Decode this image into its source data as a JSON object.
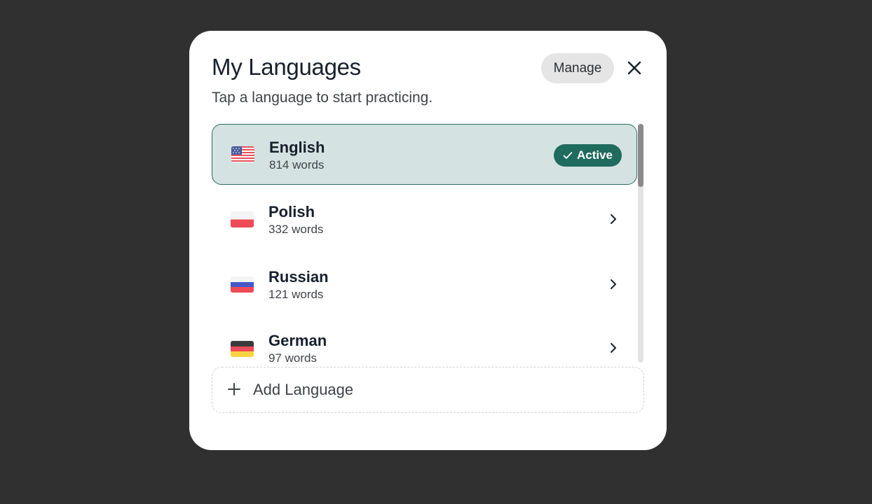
{
  "modal": {
    "title": "My Languages",
    "subtitle": "Tap a language to start practicing.",
    "manage_label": "Manage",
    "close_icon": "close-icon"
  },
  "languages": [
    {
      "name": "English",
      "count": "814 words",
      "flag": "us-flag-icon",
      "active": true,
      "badge": "Active"
    },
    {
      "name": "Polish",
      "count": "332 words",
      "flag": "pl-flag-icon",
      "active": false
    },
    {
      "name": "Russian",
      "count": "121 words",
      "flag": "ru-flag-icon",
      "active": false
    },
    {
      "name": "German",
      "count": "97 words",
      "flag": "de-flag-icon",
      "active": false
    }
  ],
  "add_language": {
    "label": "Add Language",
    "icon": "plus-icon"
  },
  "colors": {
    "backdrop": "#303030",
    "accent": "#1f6b5e",
    "active_row_bg": "#d4e3e1"
  }
}
